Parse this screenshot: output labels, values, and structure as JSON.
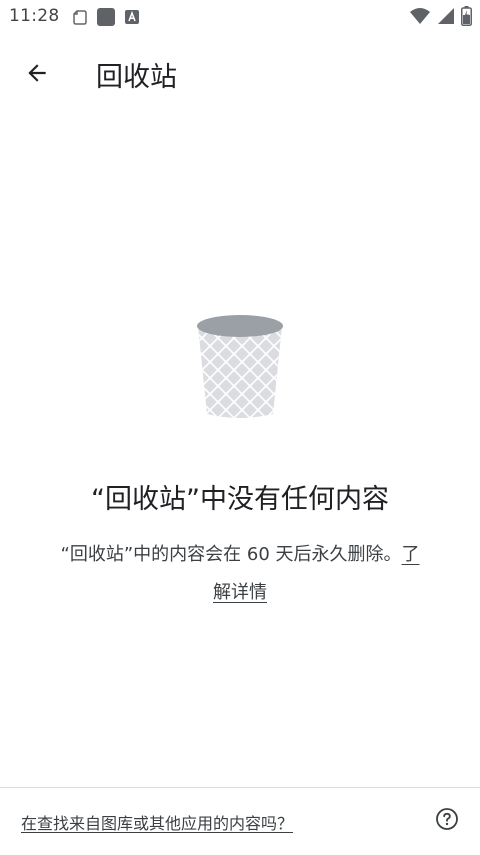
{
  "status_bar": {
    "time": "11:28",
    "left_icons": [
      "clipboard-icon",
      "app-square-icon",
      "font-a-icon"
    ],
    "right_icons": [
      "wifi-icon",
      "cell-signal-icon",
      "battery-icon"
    ]
  },
  "app_bar": {
    "back_icon": "arrow-back-icon",
    "title": "回收站"
  },
  "empty_state": {
    "illustration": "trash-bin-icon",
    "title": "“回收站”中没有任何内容",
    "description": "“回收站”中的内容会在 60 天后永久删除。",
    "learn_more": "了解详情"
  },
  "footer": {
    "link_text": "在查找来自图库或其他应用的内容吗？",
    "help_icon": "help-circle-icon"
  },
  "colors": {
    "text_primary": "#202124",
    "text_secondary": "#3c4043",
    "trash_body": "#dadce0",
    "trash_lid": "#9aa0a6",
    "divider": "#dadce0"
  }
}
